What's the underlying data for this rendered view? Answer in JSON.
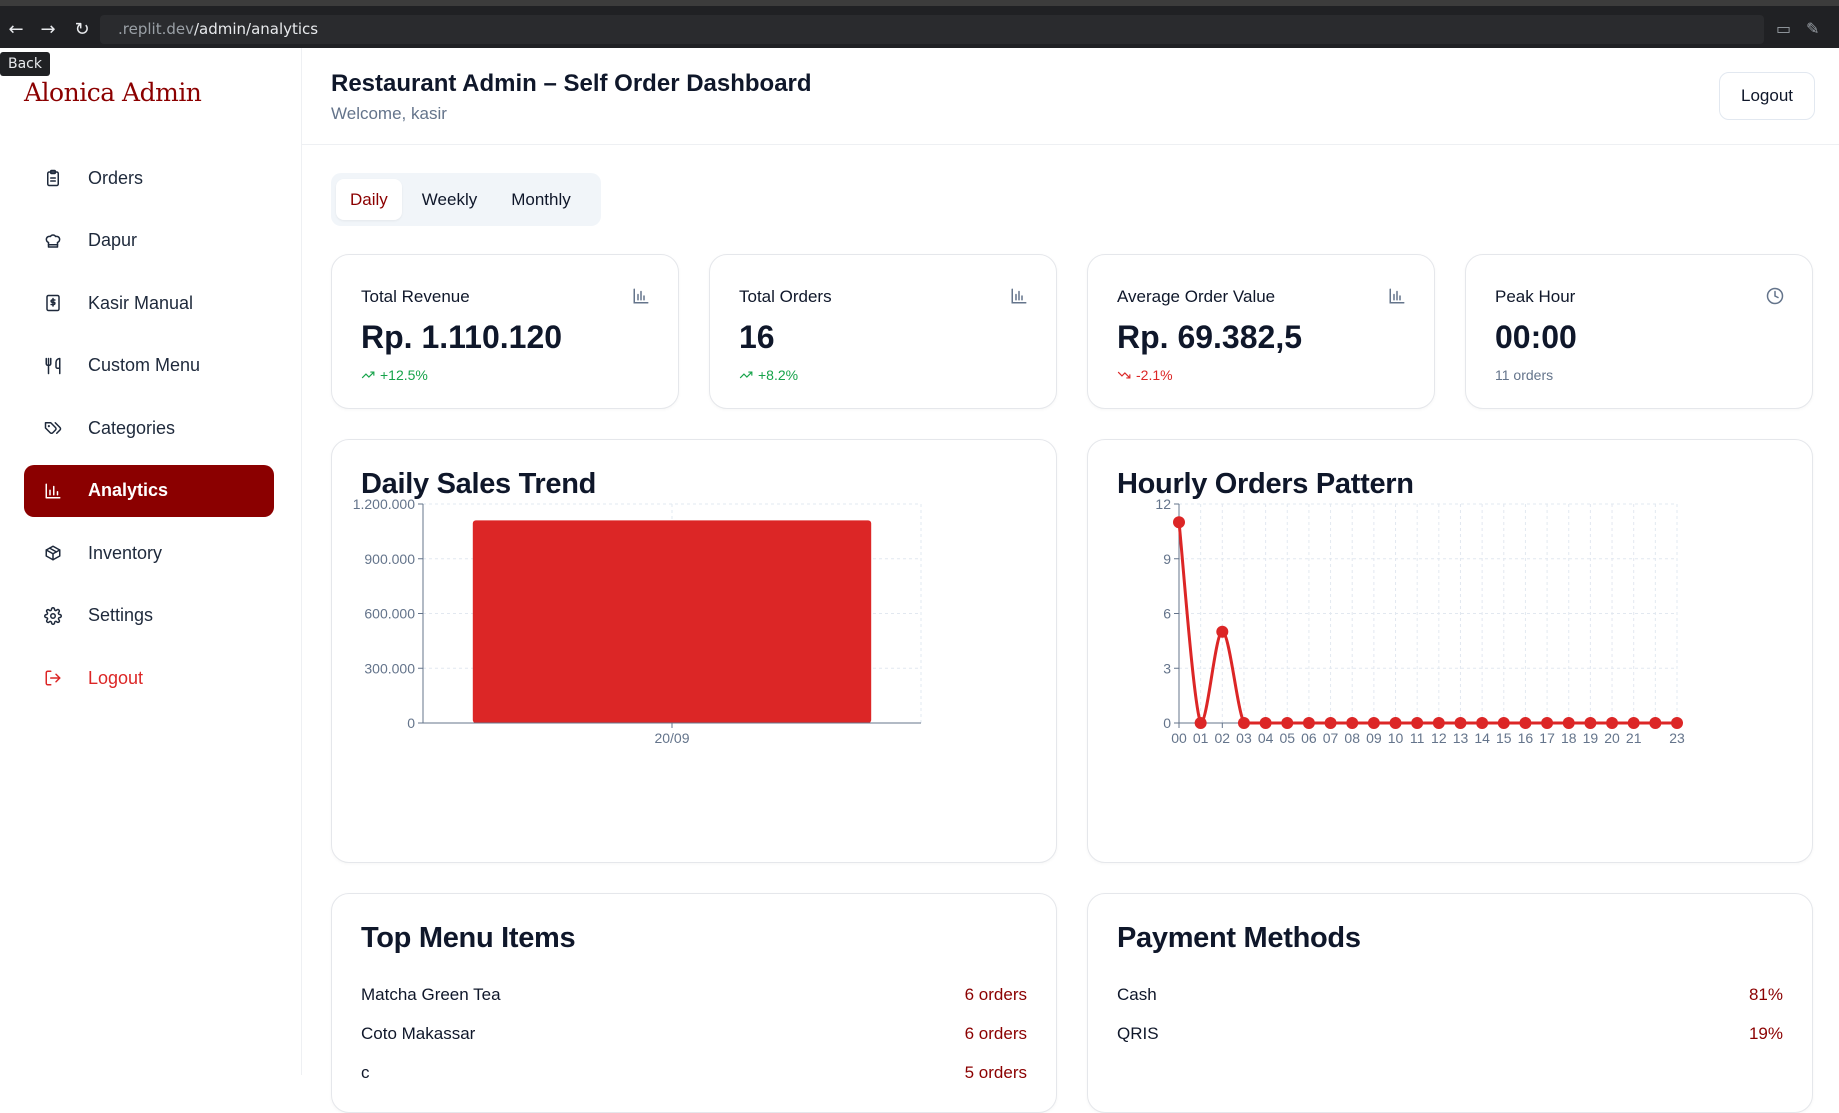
{
  "browser": {
    "url_prefix": ".replit.dev",
    "url_path": "/admin/analytics",
    "tooltip": "Back"
  },
  "sidebar": {
    "brand": "Alonica Admin",
    "items": [
      {
        "label": "Orders",
        "icon": "clipboard-icon"
      },
      {
        "label": "Dapur",
        "icon": "chef-hat-icon"
      },
      {
        "label": "Kasir Manual",
        "icon": "receipt-icon"
      },
      {
        "label": "Custom Menu",
        "icon": "utensils-icon"
      },
      {
        "label": "Categories",
        "icon": "tags-icon"
      },
      {
        "label": "Analytics",
        "icon": "bar-chart-icon",
        "active": true
      },
      {
        "label": "Inventory",
        "icon": "package-icon"
      },
      {
        "label": "Settings",
        "icon": "gear-icon"
      },
      {
        "label": "Logout",
        "icon": "logout-icon"
      }
    ]
  },
  "header": {
    "title": "Restaurant Admin – Self Order Dashboard",
    "welcome": "Welcome, kasir",
    "logout_label": "Logout"
  },
  "tabs": [
    "Daily",
    "Weekly",
    "Monthly"
  ],
  "active_tab": "Daily",
  "stats": [
    {
      "label": "Total Revenue",
      "value": "Rp. 1.110.120",
      "sub": "+12.5%",
      "trend": "up",
      "icon": "bar-chart-icon"
    },
    {
      "label": "Total Orders",
      "value": "16",
      "sub": "+8.2%",
      "trend": "up",
      "icon": "bar-chart-icon"
    },
    {
      "label": "Average Order Value",
      "value": "Rp. 69.382,5",
      "sub": "-2.1%",
      "trend": "down",
      "icon": "bar-chart-icon"
    },
    {
      "label": "Peak Hour",
      "value": "00:00",
      "sub": "11 orders",
      "trend": "neutral",
      "icon": "clock-icon"
    }
  ],
  "colors": {
    "brand": "#8b0000",
    "chart": "#dc2626",
    "up": "#16a34a",
    "down": "#dc2626"
  },
  "chart_data": [
    {
      "type": "bar",
      "title": "Daily Sales Trend",
      "categories": [
        "20/09"
      ],
      "values": [
        1110120
      ],
      "ylim": [
        0,
        1200000
      ],
      "yticks": [
        0,
        300000,
        600000,
        900000,
        1200000
      ],
      "ytick_labels": [
        "0",
        "300.000",
        "600.000",
        "900.000",
        "1.200.000"
      ],
      "grid": true
    },
    {
      "type": "line",
      "title": "Hourly Orders Pattern",
      "x": [
        "00",
        "01",
        "02",
        "03",
        "04",
        "05",
        "06",
        "07",
        "08",
        "09",
        "10",
        "11",
        "12",
        "13",
        "14",
        "15",
        "16",
        "17",
        "18",
        "19",
        "20",
        "21",
        "22",
        "23"
      ],
      "xtick_labels": [
        "00",
        "01",
        "02",
        "03",
        "04",
        "05",
        "06",
        "07",
        "08",
        "09",
        "10",
        "11",
        "12",
        "13",
        "14",
        "15",
        "16",
        "17",
        "18",
        "19",
        "20",
        "21",
        "",
        "23"
      ],
      "values": [
        11,
        0,
        5,
        0,
        0,
        0,
        0,
        0,
        0,
        0,
        0,
        0,
        0,
        0,
        0,
        0,
        0,
        0,
        0,
        0,
        0,
        0,
        0,
        0
      ],
      "ylim": [
        0,
        12
      ],
      "yticks": [
        0,
        3,
        6,
        9,
        12
      ],
      "grid": true
    }
  ],
  "top_menu": {
    "title": "Top Menu Items",
    "items": [
      {
        "name": "Matcha Green Tea",
        "value": "6 orders"
      },
      {
        "name": "Coto Makassar",
        "value": "6 orders"
      },
      {
        "name": "c",
        "value": "5 orders"
      }
    ]
  },
  "payment": {
    "title": "Payment Methods",
    "items": [
      {
        "name": "Cash",
        "value": "81%"
      },
      {
        "name": "QRIS",
        "value": "19%"
      }
    ]
  }
}
